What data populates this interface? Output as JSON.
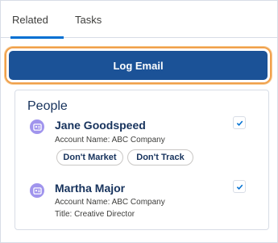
{
  "tabs": [
    {
      "label": "Related",
      "active": true
    },
    {
      "label": "Tasks",
      "active": false
    }
  ],
  "action": {
    "label": "Log Email"
  },
  "people_card": {
    "title": "People",
    "people": [
      {
        "name": "Jane Goodspeed",
        "account": "Account Name: ABC Company",
        "checked": true,
        "tags": [
          "Don't Market",
          "Don't Track"
        ]
      },
      {
        "name": "Martha Major",
        "account": "Account Name: ABC Company",
        "title": "Title: Creative Director",
        "checked": true
      }
    ]
  },
  "colors": {
    "accent": "#0070d2",
    "button": "#1b5297",
    "highlight": "#f0a04b",
    "avatar": "#a094ed"
  }
}
